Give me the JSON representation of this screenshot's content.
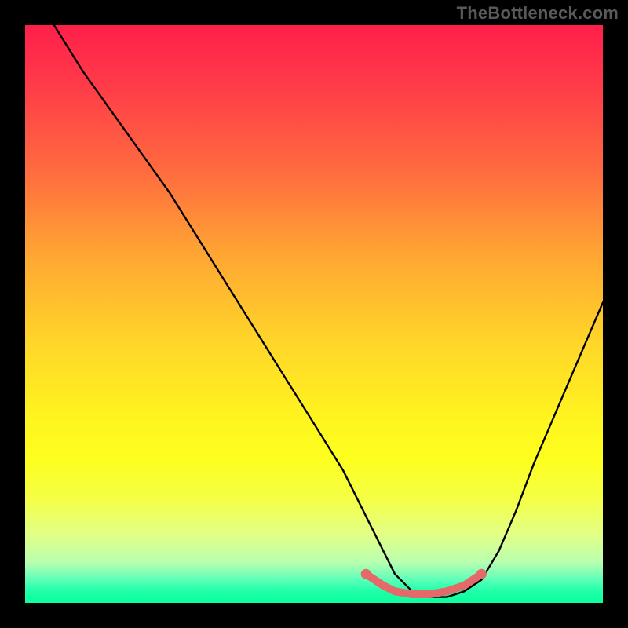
{
  "watermark": "TheBottleneck.com",
  "chart_data": {
    "type": "line",
    "title": "",
    "xlabel": "",
    "ylabel": "",
    "xlim": [
      0,
      100
    ],
    "ylim": [
      0,
      100
    ],
    "gradient_colors_top_to_bottom": [
      "#ff1f4a",
      "#ff6a3f",
      "#ffd629",
      "#fdff1e",
      "#1effa9"
    ],
    "series": [
      {
        "name": "curve",
        "color": "#000000",
        "x": [
          5,
          10,
          15,
          20,
          25,
          30,
          35,
          40,
          45,
          50,
          55,
          59,
          62,
          64,
          67,
          70,
          73,
          76,
          79,
          82,
          85,
          88,
          91,
          94,
          97,
          100
        ],
        "y": [
          100,
          92,
          85,
          78,
          71,
          63,
          55,
          47,
          39,
          31,
          23,
          15,
          9,
          5,
          2,
          1,
          1,
          2,
          4,
          9,
          16,
          24,
          31,
          38,
          45,
          52
        ]
      },
      {
        "name": "highlight-range",
        "color": "#e46a6a",
        "type": "scatter",
        "x": [
          59,
          62,
          64,
          67,
          70,
          73,
          76,
          79
        ],
        "y": [
          5,
          3,
          2,
          1.5,
          1.5,
          2,
          3,
          5
        ]
      }
    ],
    "notes": "V-shaped/bottleneck minimum near x≈70. Red/pink dots mark flat optimal region. Background gradient encodes value: red=high bottleneck, green=low."
  }
}
